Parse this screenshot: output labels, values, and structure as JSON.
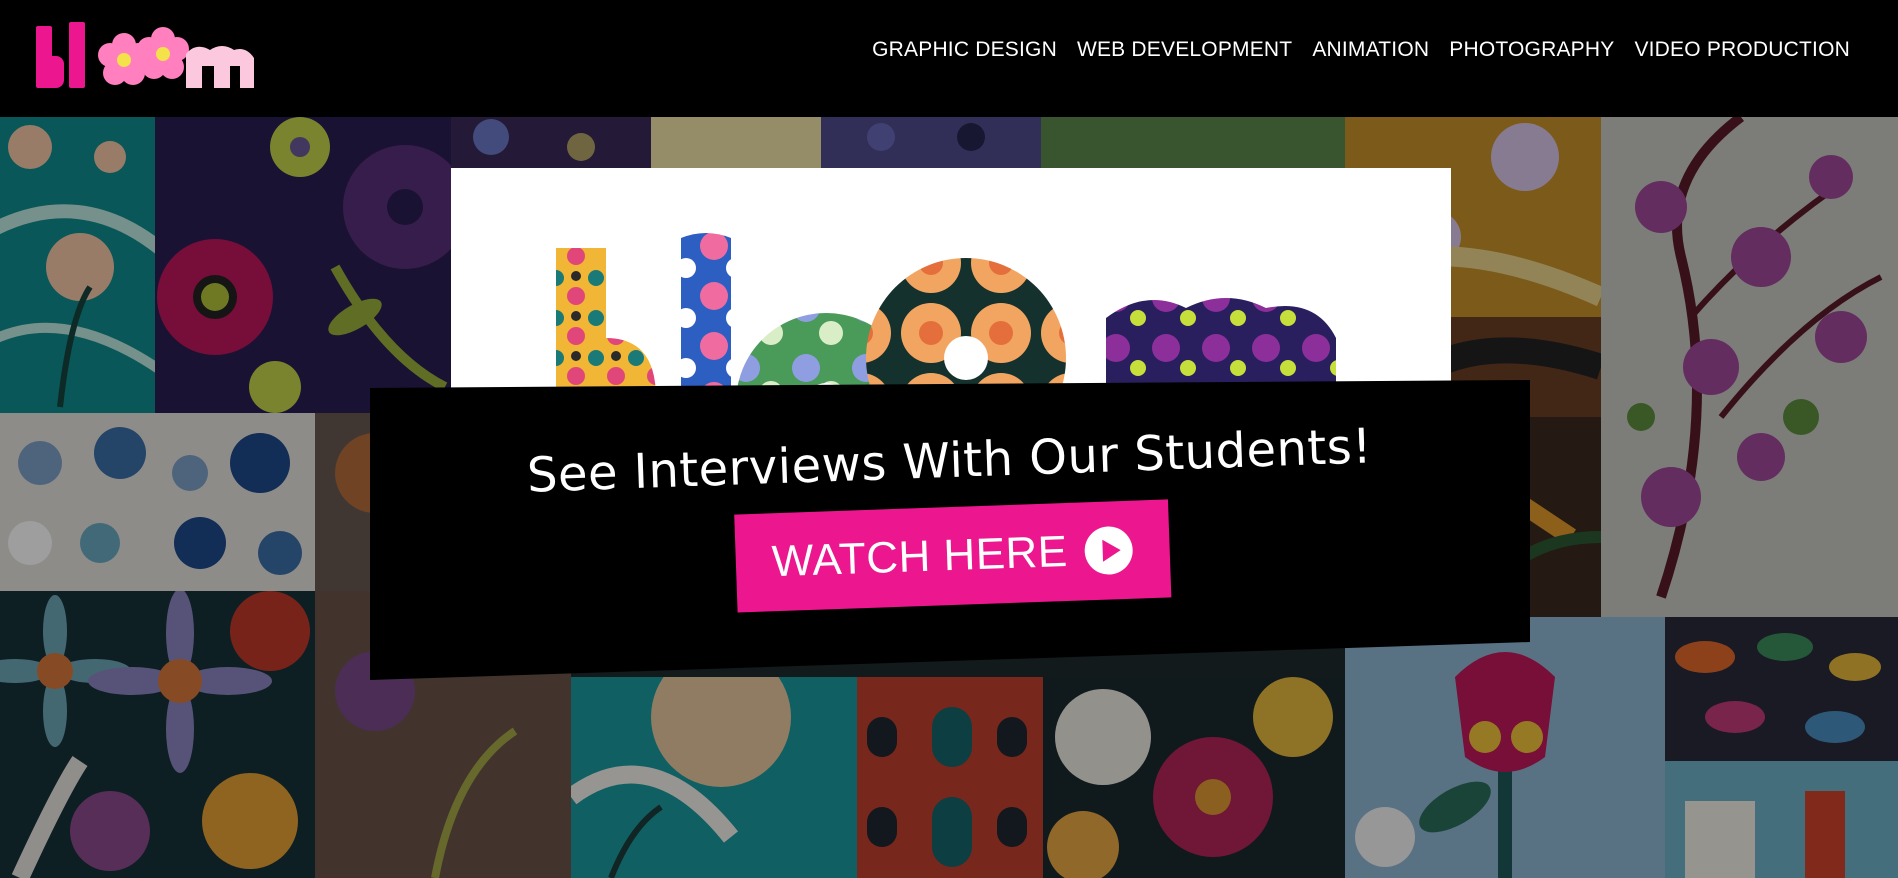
{
  "brand": {
    "logo_text": "bloom",
    "accent": "#ec178f",
    "logo_pink_light": "#fbc8dd"
  },
  "nav": {
    "items": [
      {
        "label": "GRAPHIC DESIGN"
      },
      {
        "label": "WEB DEVELOPMENT"
      },
      {
        "label": "ANIMATION"
      },
      {
        "label": "PHOTOGRAPHY"
      },
      {
        "label": "VIDEO PRODUCTION"
      }
    ]
  },
  "hero": {
    "headline": "See Interviews With Our Students!",
    "cta_label": "WATCH HERE",
    "cta_icon": "play-circle-icon"
  }
}
